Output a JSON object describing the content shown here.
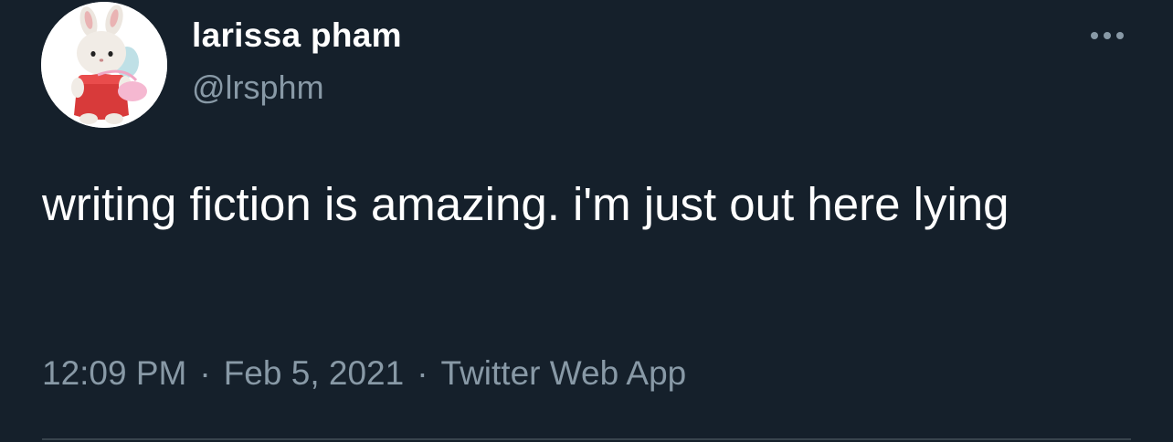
{
  "user": {
    "display_name": "larissa pham",
    "handle": "@lrsphm",
    "avatar_icon": "plush-bunny-avatar"
  },
  "tweet": {
    "text": "writing fiction is amazing. i'm just out here lying",
    "time": "12:09 PM",
    "separator": "·",
    "date": "Feb 5, 2021",
    "source": "Twitter Web App"
  },
  "menu": {
    "icon": "more-icon"
  },
  "colors": {
    "background": "#15202b",
    "text_primary": "#ffffff",
    "text_secondary": "#8899a6",
    "divider": "#38444d"
  }
}
